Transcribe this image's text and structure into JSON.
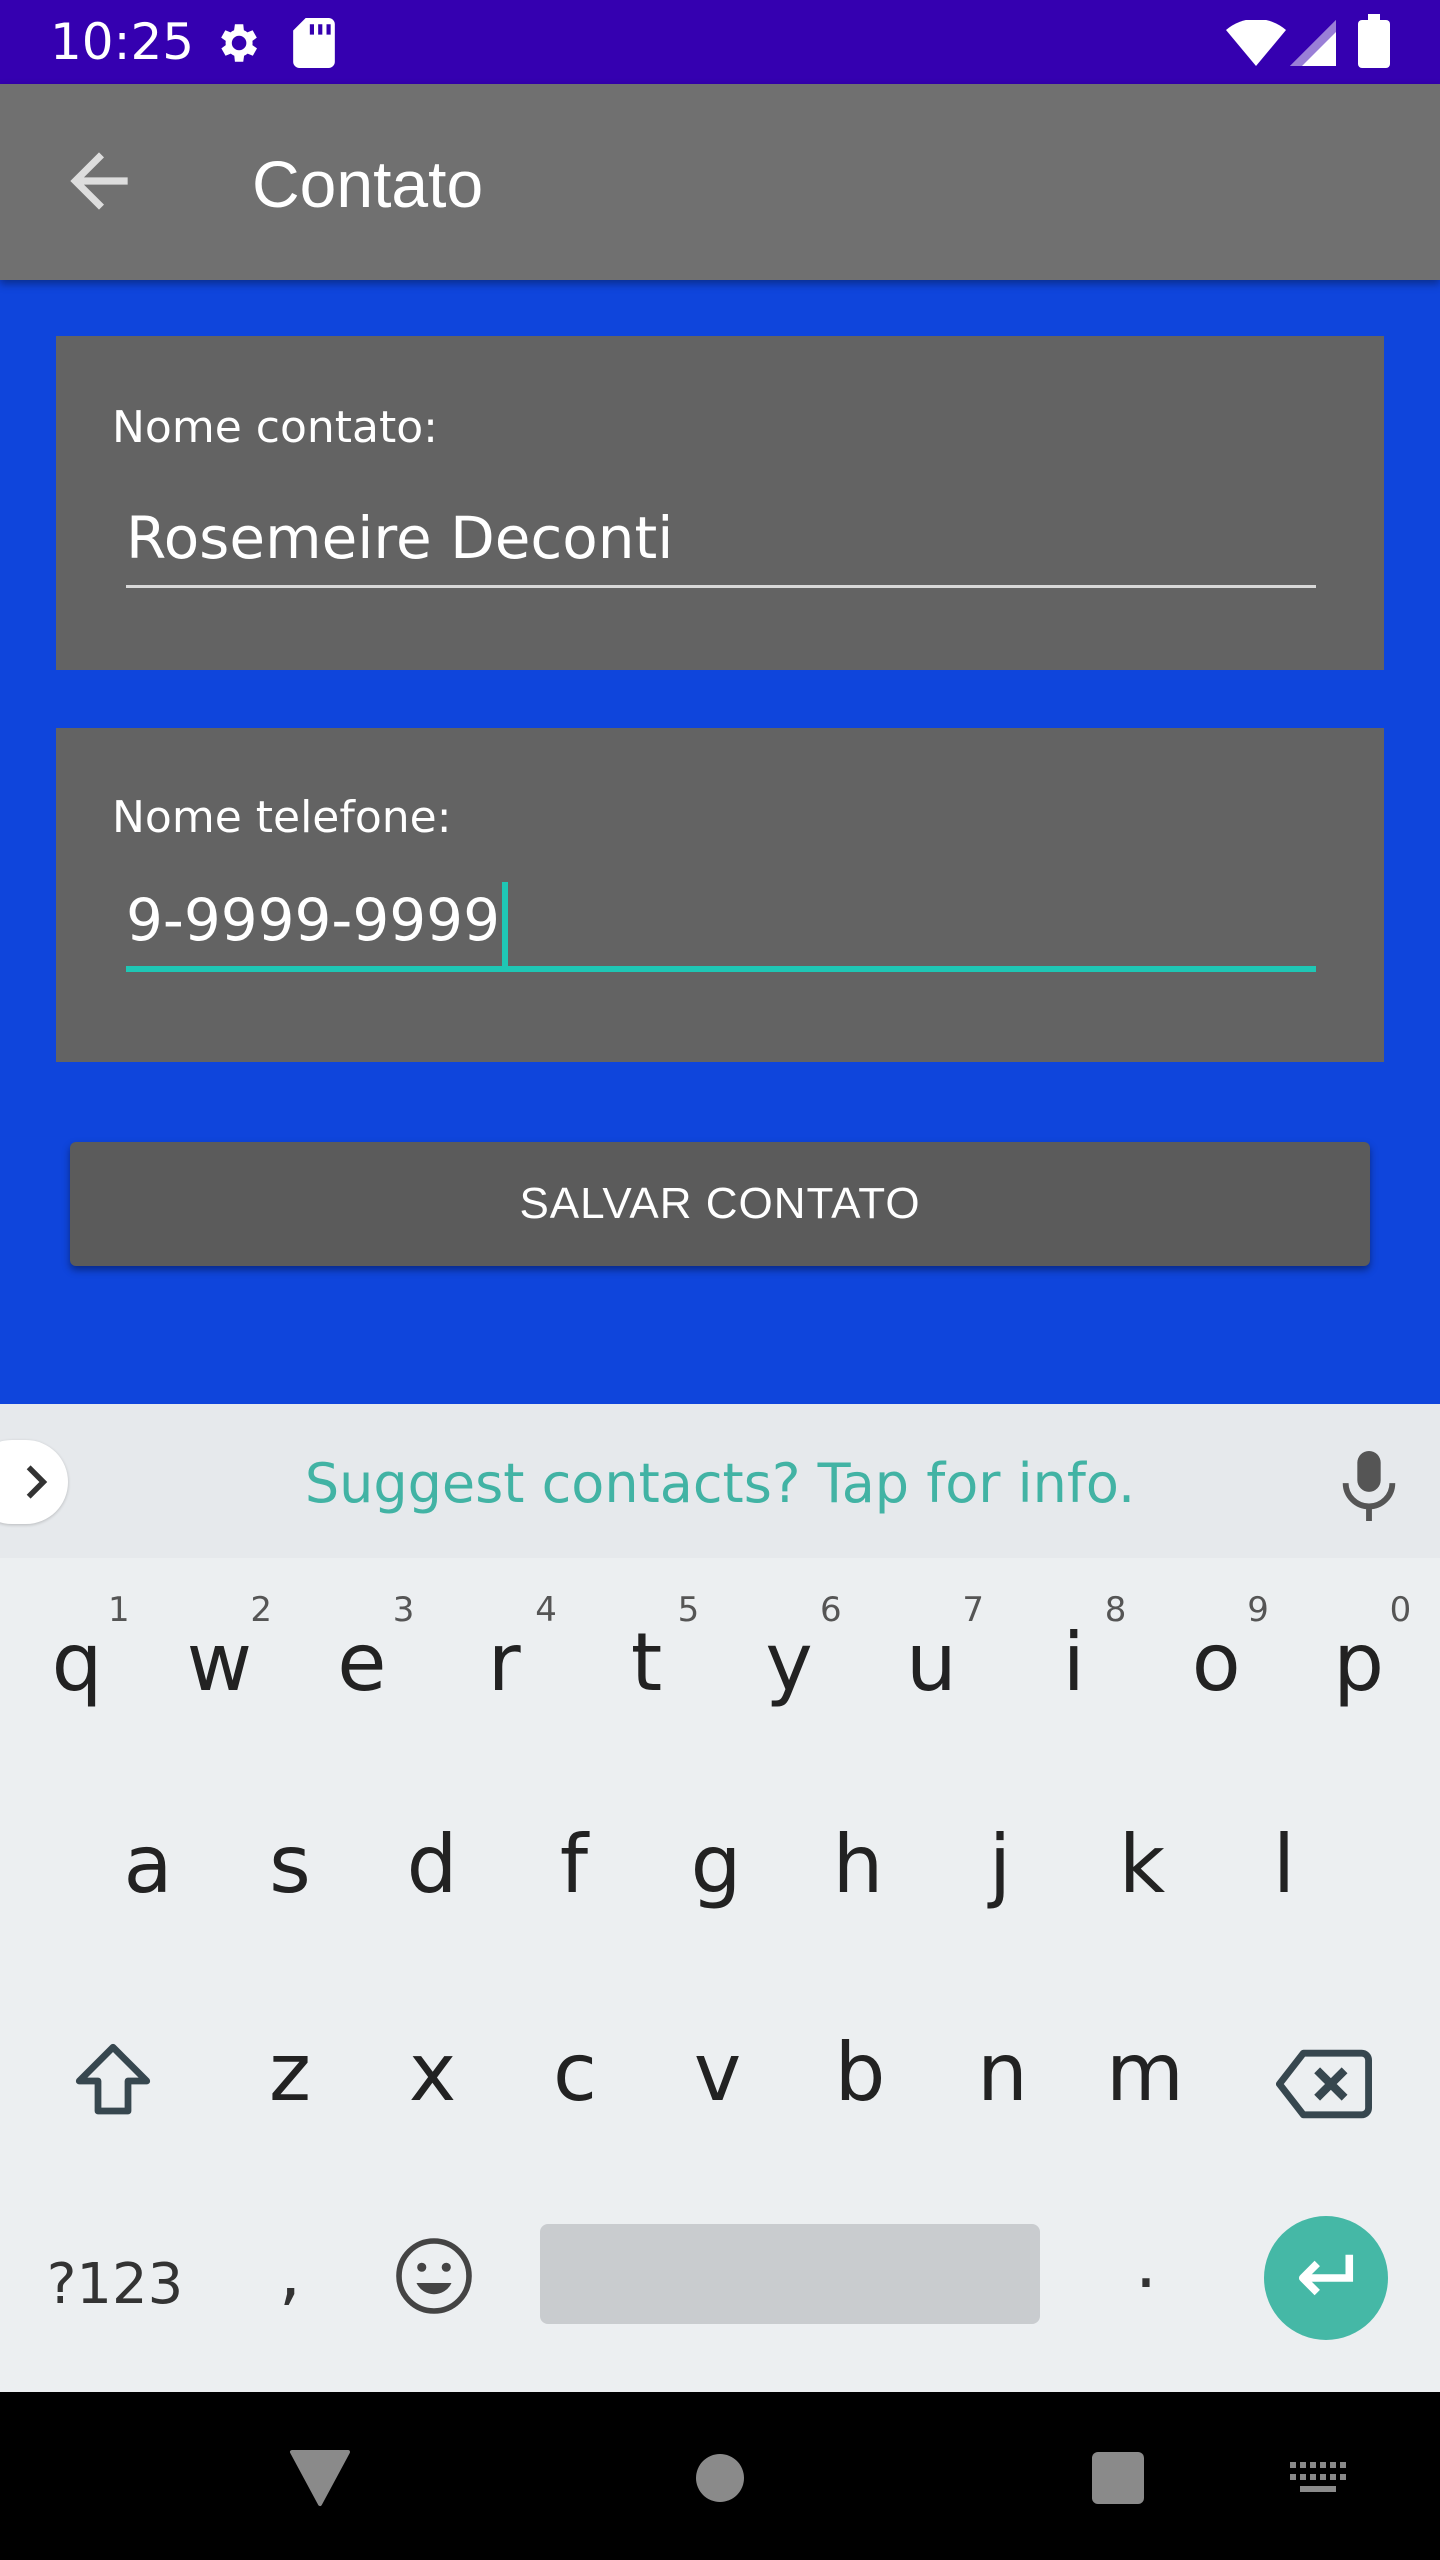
{
  "status_bar": {
    "time": "10:25",
    "icons": [
      "settings-icon",
      "sd-card-icon",
      "wifi-icon",
      "signal-icon",
      "battery-icon"
    ]
  },
  "app_bar": {
    "title": "Contato",
    "back_icon": "arrow-back-icon"
  },
  "form": {
    "contact_label": "Nome contato:",
    "contact_value": "Rosemeire Deconti",
    "phone_label": "Nome telefone:",
    "phone_value": "9-9999-9999",
    "save_label": "SALVAR CONTATO"
  },
  "keyboard": {
    "suggestion": "Suggest contacts? Tap for info.",
    "row1": [
      {
        "ch": "q",
        "hint": "1"
      },
      {
        "ch": "w",
        "hint": "2"
      },
      {
        "ch": "e",
        "hint": "3"
      },
      {
        "ch": "r",
        "hint": "4"
      },
      {
        "ch": "t",
        "hint": "5"
      },
      {
        "ch": "y",
        "hint": "6"
      },
      {
        "ch": "u",
        "hint": "7"
      },
      {
        "ch": "i",
        "hint": "8"
      },
      {
        "ch": "o",
        "hint": "9"
      },
      {
        "ch": "p",
        "hint": "0"
      }
    ],
    "row2": [
      "a",
      "s",
      "d",
      "f",
      "g",
      "h",
      "j",
      "k",
      "l"
    ],
    "row3": [
      "z",
      "x",
      "c",
      "v",
      "b",
      "n",
      "m"
    ],
    "symbols_label": "?123",
    "comma_label": ",",
    "period_label": "."
  },
  "colors": {
    "status_bar": "#3500B0",
    "app_bar": "#707070",
    "content_bg": "#0F45DC",
    "card_bg": "#636363",
    "accent": "#1FC7B5",
    "enter_key": "#45B8A6"
  }
}
